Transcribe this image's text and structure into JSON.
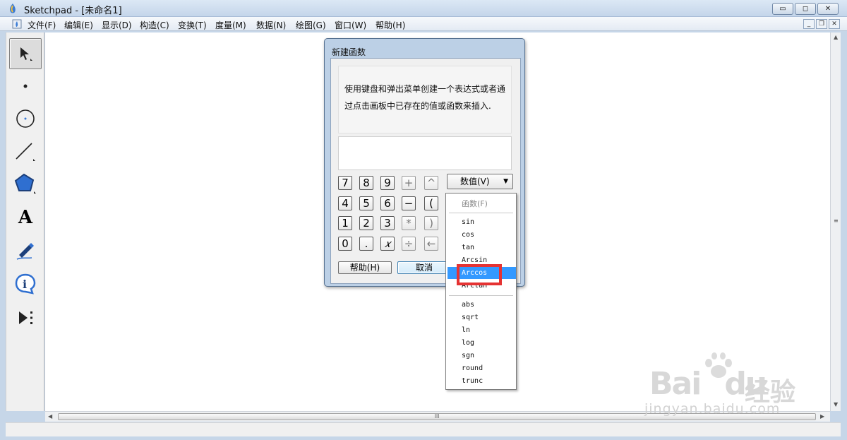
{
  "window": {
    "title": "Sketchpad  - [未命名1]",
    "min": "▭",
    "max": "◻",
    "close": "✕"
  },
  "menubar": {
    "items": [
      "文件(F)",
      "编辑(E)",
      "显示(D)",
      "构造(C)",
      "变换(T)",
      "度量(M)",
      "数据(N)",
      "绘图(G)",
      "窗口(W)",
      "帮助(H)"
    ],
    "mdi": [
      "_",
      "❐",
      "✕"
    ]
  },
  "toolbox": {
    "tools": [
      "arrow-select-tool",
      "point-tool",
      "compass-tool",
      "straightedge-tool",
      "polygon-tool",
      "text-tool",
      "marker-tool",
      "information-tool",
      "custom-tool"
    ],
    "text_glyph": "A"
  },
  "dialog": {
    "title": "新建函数",
    "help_text": "使用键盘和弹出菜单创建一个表达式或者通过点击画板中已存在的值或函数来插入.",
    "expression": "",
    "keypad": {
      "row1": [
        "7",
        "8",
        "9",
        "+",
        "^"
      ],
      "row2": [
        "4",
        "5",
        "6",
        "−",
        "("
      ],
      "row3": [
        "1",
        "2",
        "3",
        "*",
        ")"
      ],
      "row4": [
        "0",
        ".",
        "𝑥",
        "÷",
        "←"
      ]
    },
    "value_button": "数值(V)",
    "help_button": "帮助(H)",
    "cancel_button": "取消"
  },
  "dropdown": {
    "header": "函数(F)",
    "group1": [
      "sin",
      "cos",
      "tan",
      "Arcsin",
      "Arccos",
      "Arctan"
    ],
    "group2": [
      "abs",
      "sqrt",
      "ln",
      "log",
      "sgn",
      "round",
      "trunc"
    ],
    "selected": "Arccos"
  },
  "watermark": {
    "brand": "Bai",
    "brand_tail": "du",
    "suffix": "经验",
    "url": "jingyan.baidu.com"
  },
  "scroll": {
    "grip": "III"
  },
  "colors": {
    "selection": "#3399ff",
    "highlight_box": "#e53333",
    "title_bg": "#c4d5ea"
  }
}
